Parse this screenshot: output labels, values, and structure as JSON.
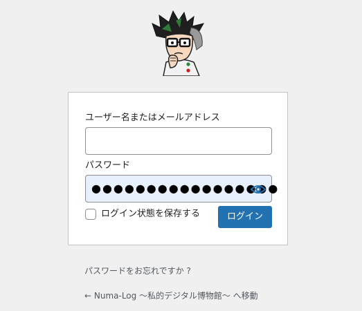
{
  "login_form": {
    "username_label": "ユーザー名またはメールアドレス",
    "username_value": "",
    "password_label": "パスワード",
    "password_masked": "●●●●●●●●●●●●●●●●●",
    "remember_label": "ログイン状態を保存する",
    "remember_checked": false,
    "submit_label": "ログイン"
  },
  "links": {
    "lost_password": "パスワードをお忘れですか ?",
    "back_to_site": "← Numa-Log 〜私的デジタル博物館〜 へ移動"
  },
  "icons": {
    "logo": "site-logo-avatar",
    "password_toggle": "eye-icon"
  },
  "colors": {
    "background": "#f0f0f1",
    "primary_button": "#2271b1",
    "autofill_input": "#e8f0fe"
  }
}
